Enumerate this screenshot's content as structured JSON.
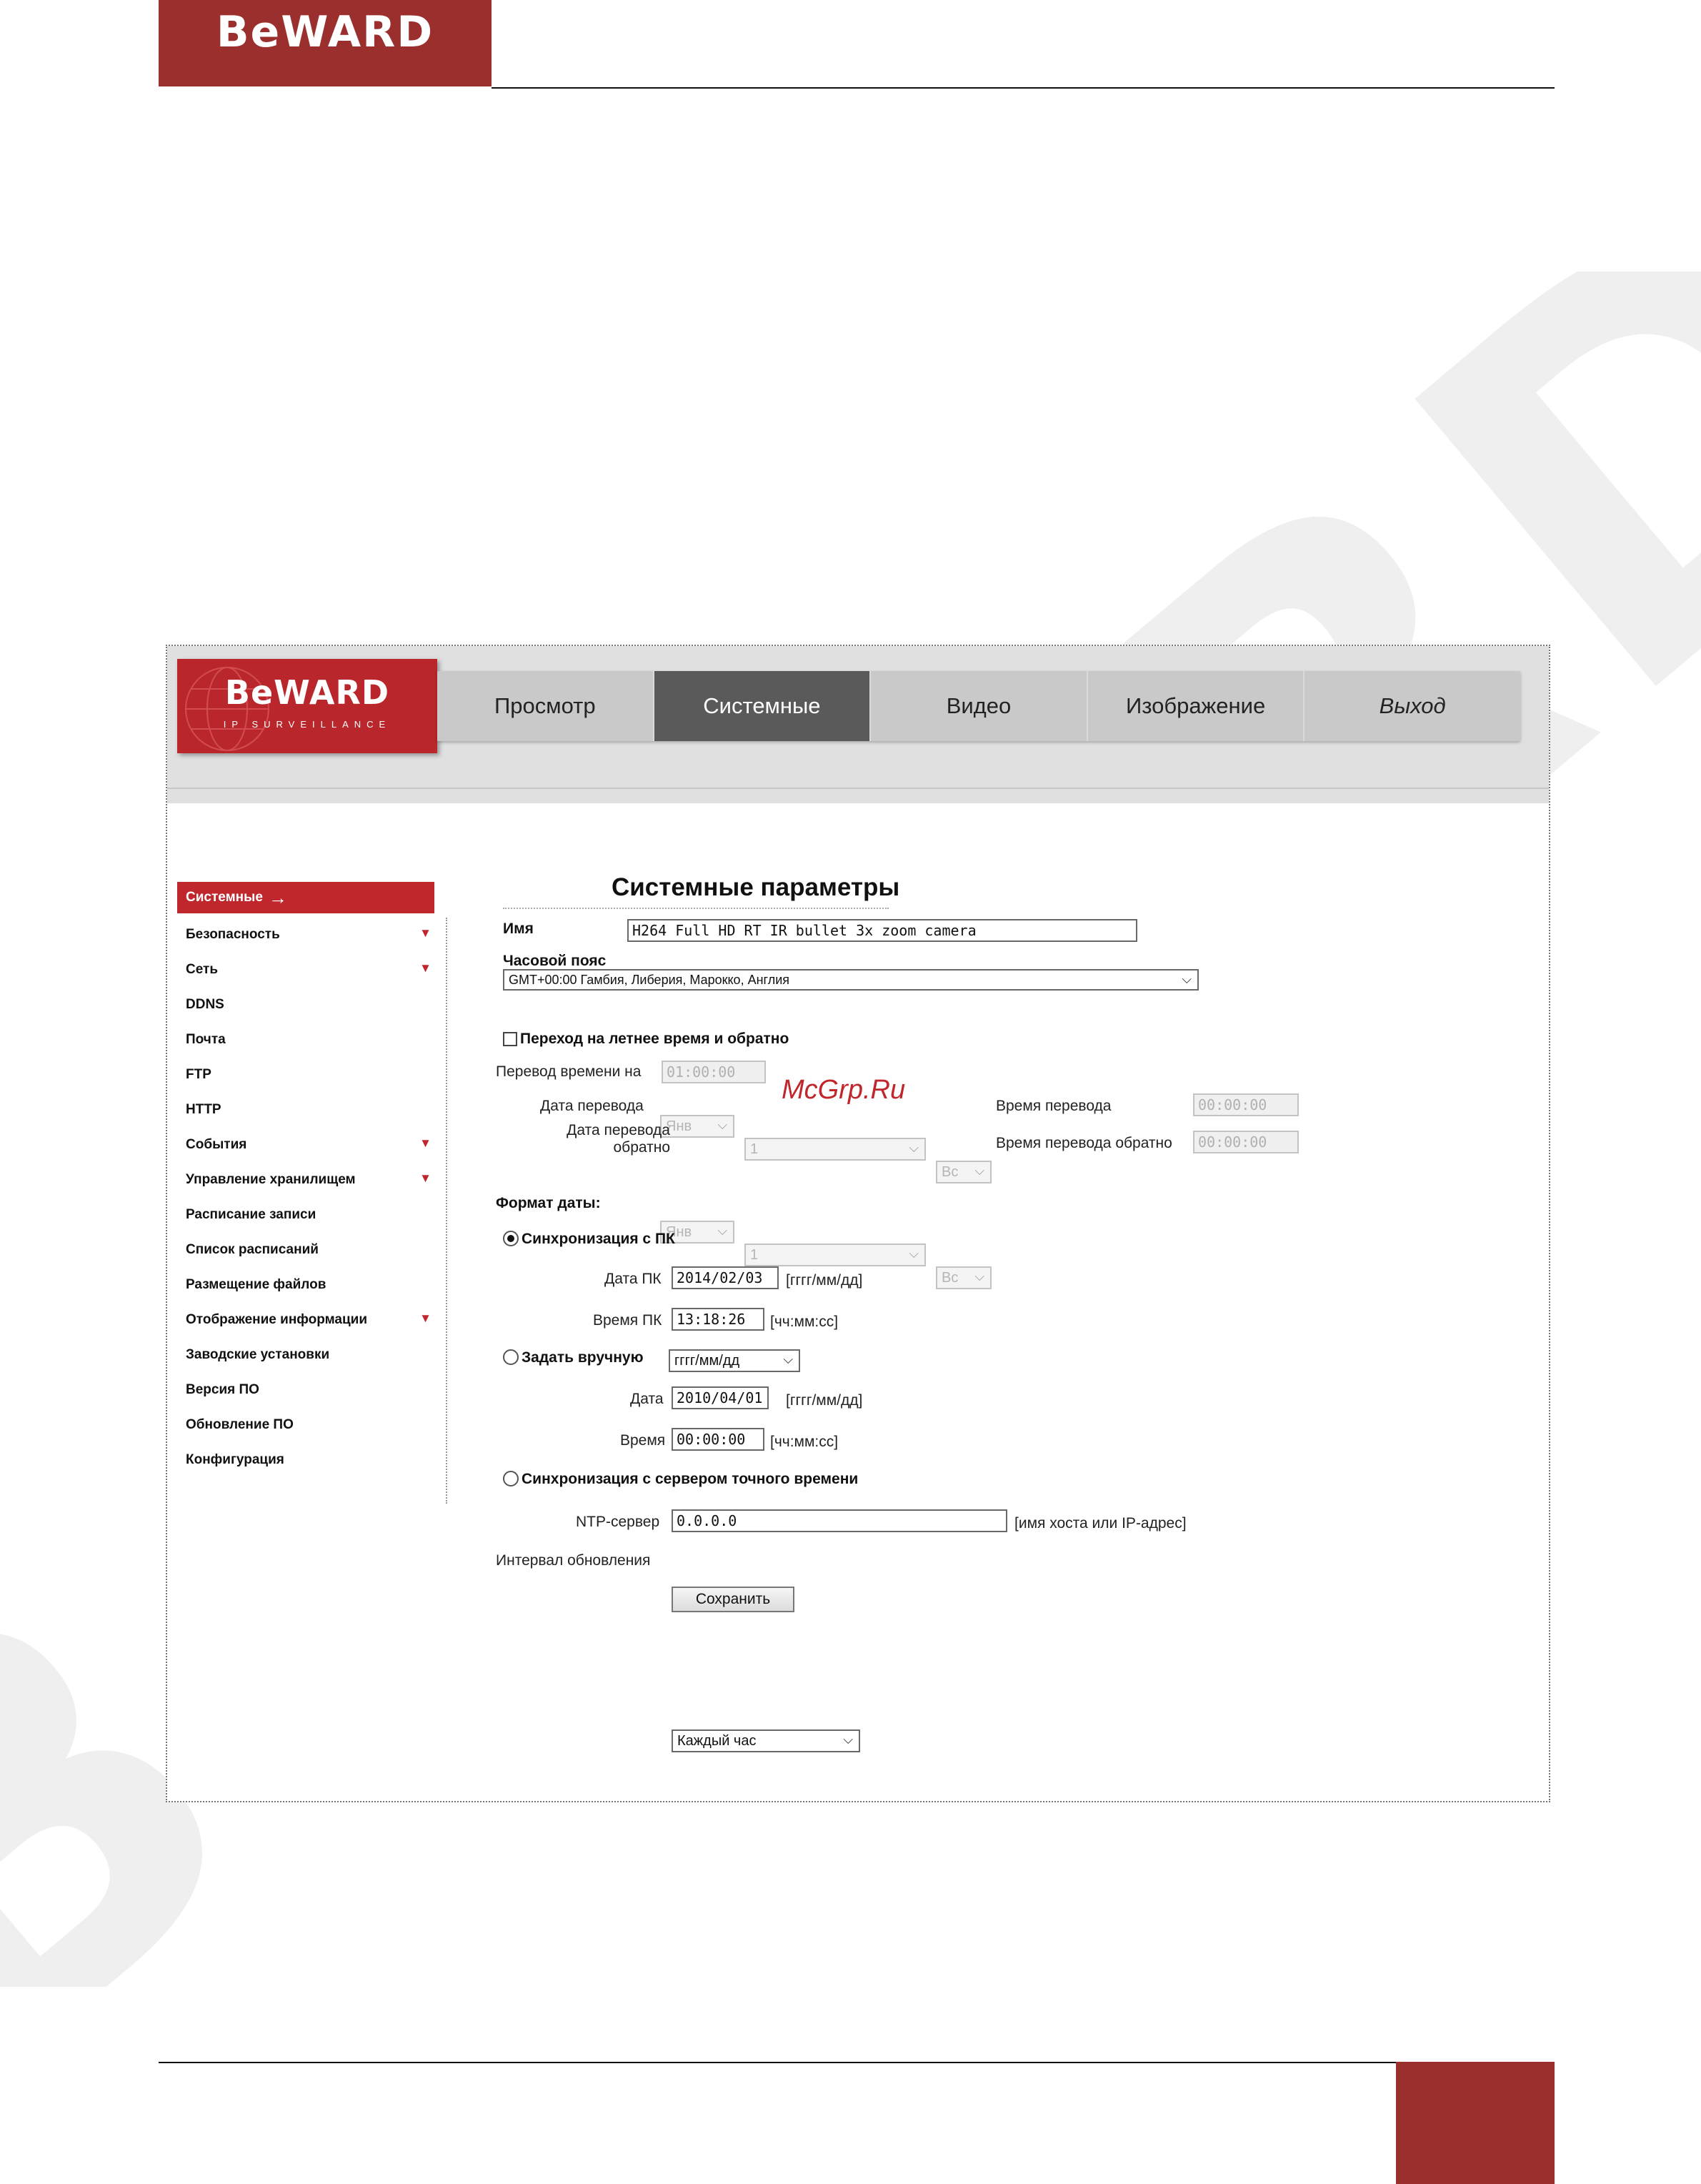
{
  "page": {
    "brand": "BeWARD",
    "footer_page_number": ""
  },
  "camera_ui": {
    "logo": {
      "brand": "BeWARD",
      "subtitle": "IP SURVEILLANCE"
    },
    "nav": [
      "Просмотр",
      "Системные",
      "Видео",
      "Изображение",
      "Выход"
    ],
    "nav_active_index": 1,
    "sidebar": [
      {
        "label": "Системные",
        "active": true,
        "arrow": "→"
      },
      {
        "label": "Безопасность",
        "expand": true
      },
      {
        "label": "Сеть",
        "expand": true
      },
      {
        "label": "DDNS"
      },
      {
        "label": "Почта"
      },
      {
        "label": "FTP"
      },
      {
        "label": "HTTP"
      },
      {
        "label": "События",
        "expand": true
      },
      {
        "label": "Управление хранилищем",
        "expand": true
      },
      {
        "label": "Расписание записи"
      },
      {
        "label": "Список расписаний"
      },
      {
        "label": "Размещение файлов"
      },
      {
        "label": "Отображение информации",
        "expand": true
      },
      {
        "label": "Заводские установки"
      },
      {
        "label": "Версия ПО"
      },
      {
        "label": "Обновление ПО"
      },
      {
        "label": "Конфигурация"
      }
    ],
    "form": {
      "title": "Системные параметры",
      "name_label": "Имя",
      "name_value": "H264 Full HD RT IR bullet 3x zoom camera",
      "timezone_label": "Часовой пояс",
      "timezone_value": "GMT+00:00 Гамбия, Либерия, Марокко, Англия",
      "dst_label": "Переход на летнее время и обратно",
      "dst_checked": false,
      "shift_label": "Перевод времени на",
      "shift_value": "01:00:00",
      "date_shift_label": "Дата перевода",
      "date_back_label": "Дата перевода обратно",
      "month_value": "Янв",
      "day_value": "1",
      "weekday_value": "Вс",
      "time_shift_label": "Время перевода",
      "time_shift_value": "00:00:00",
      "time_back_label": "Время перевода обратно",
      "time_back_value": "00:00:00",
      "date_format_label": "Формат даты:",
      "date_format_value": "гггг/мм/дд",
      "sync_pc_label": "Синхронизация с ПК",
      "pc_date_label": "Дата ПК",
      "pc_date_value": "2014/02/03",
      "date_hint": "[гггг/мм/дд]",
      "pc_time_label": "Время ПК",
      "pc_time_value": "13:18:26",
      "time_hint": "[чч:мм:сс]",
      "manual_label": "Задать вручную",
      "date_label": "Дата",
      "date_value": "2010/04/01",
      "time_label": "Время",
      "time_value": "00:00:00",
      "ntp_sync_label": "Синхронизация с сервером точного времени",
      "ntp_server_label": "NTP-сервер",
      "ntp_server_value": "0.0.0.0",
      "ntp_hint": "[имя хоста или IP-адрес]",
      "interval_label": "Интервал обновления",
      "interval_value": "Каждый час",
      "save_label": "Сохранить",
      "selected_sync": "pc"
    },
    "watermark_text": "McGrp.Ru"
  },
  "colors": {
    "brand_red": "#9b2f2e",
    "ui_red": "#c0272d",
    "nav_active": "#5a5a5a",
    "nav_bg": "#c9c9c9"
  }
}
